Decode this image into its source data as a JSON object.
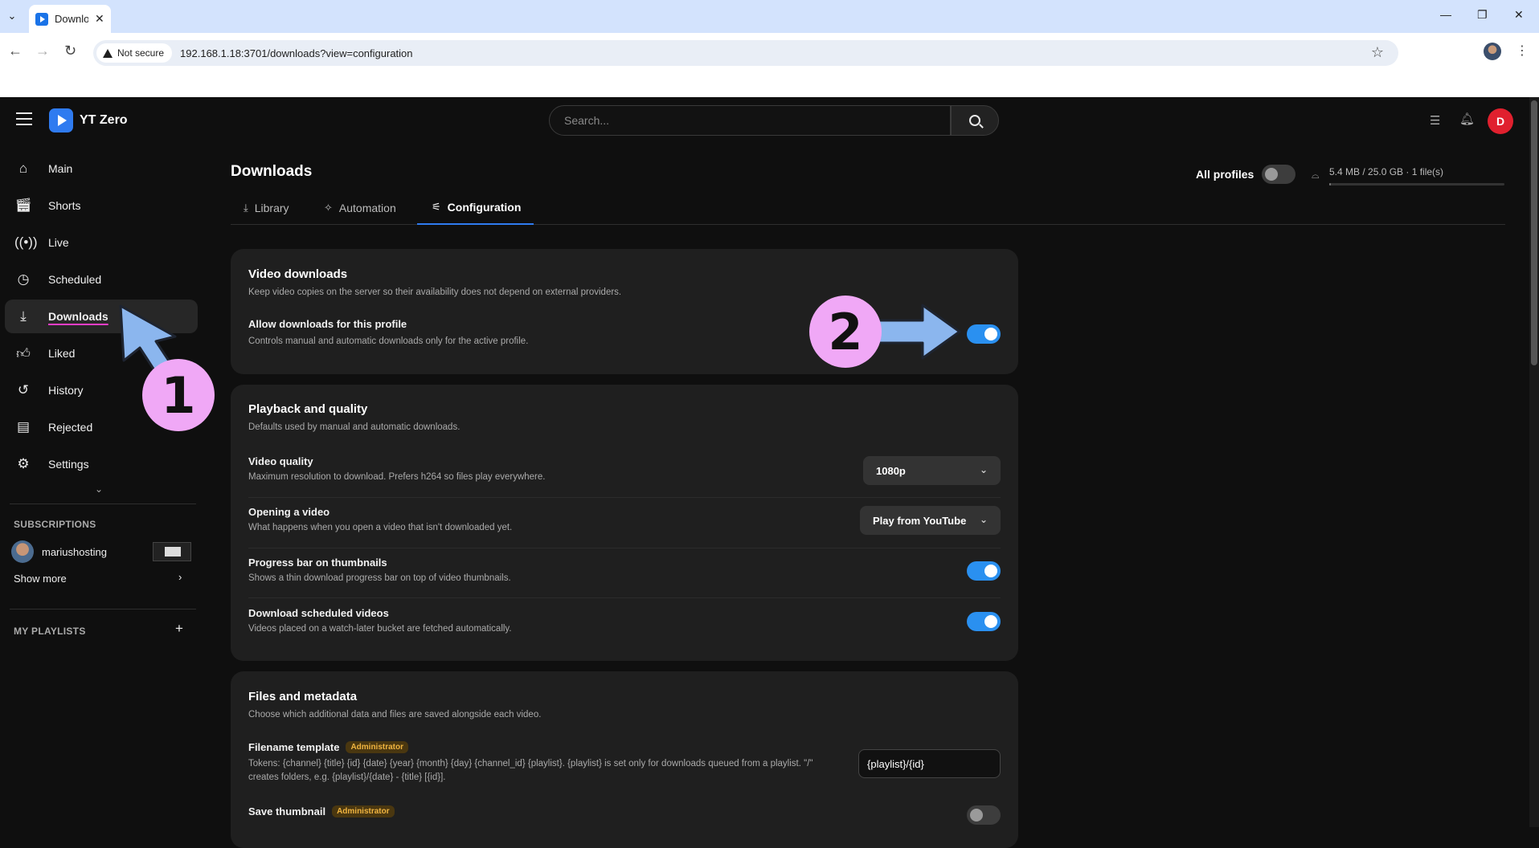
{
  "browser": {
    "tab_title": "Downlo",
    "security_label": "Not secure",
    "url": "192.168.1.18:3701/downloads?view=configuration"
  },
  "header": {
    "app_name": "YT Zero",
    "search_placeholder": "Search...",
    "avatar_letter": "D"
  },
  "sidebar": {
    "items": [
      {
        "label": "Main",
        "icon": "home-icon"
      },
      {
        "label": "Shorts",
        "icon": "clapper-icon"
      },
      {
        "label": "Live",
        "icon": "broadcast-icon"
      },
      {
        "label": "Scheduled",
        "icon": "clock-icon"
      },
      {
        "label": "Downloads",
        "icon": "download-icon",
        "active": true
      },
      {
        "label": "Liked",
        "icon": "thumbs-up-icon"
      },
      {
        "label": "History",
        "icon": "history-icon"
      },
      {
        "label": "Rejected",
        "icon": "archive-icon"
      },
      {
        "label": "Settings",
        "icon": "gear-icon"
      }
    ],
    "subscriptions_heading": "SUBSCRIPTIONS",
    "subscription_name": "mariushosting",
    "show_more": "Show more",
    "playlists_heading": "MY PLAYLISTS"
  },
  "page": {
    "title": "Downloads",
    "all_profiles_label": "All profiles",
    "all_profiles_on": false,
    "storage_text": "5.4 MB / 25.0 GB · 1 file(s)",
    "storage_fraction": 0.0002,
    "tabs": [
      {
        "label": "Library",
        "icon": "download-icon"
      },
      {
        "label": "Automation",
        "icon": "sparkle-icon"
      },
      {
        "label": "Configuration",
        "icon": "sliders-icon",
        "active": true
      }
    ]
  },
  "video_downloads": {
    "title": "Video downloads",
    "description": "Keep video copies on the server so their availability does not depend on external providers.",
    "allow_title": "Allow downloads for this profile",
    "allow_desc": "Controls manual and automatic downloads only for the active profile.",
    "allow_on": true
  },
  "playback": {
    "title": "Playback and quality",
    "description": "Defaults used by manual and automatic downloads.",
    "quality_title": "Video quality",
    "quality_desc": "Maximum resolution to download. Prefers h264 so files play everywhere.",
    "quality_value": "1080p",
    "opening_title": "Opening a video",
    "opening_desc": "What happens when you open a video that isn't downloaded yet.",
    "opening_value": "Play from YouTube",
    "progress_title": "Progress bar on thumbnails",
    "progress_desc": "Shows a thin download progress bar on top of video thumbnails.",
    "progress_on": true,
    "scheduled_title": "Download scheduled videos",
    "scheduled_desc": "Videos placed on a watch-later bucket are fetched automatically.",
    "scheduled_on": true
  },
  "files": {
    "title": "Files and metadata",
    "description": "Choose which additional data and files are saved alongside each video.",
    "filename_title": "Filename template",
    "admin_badge": "Administrator",
    "filename_desc": "Tokens: {channel} {title} {id} {date} {year} {month} {day} {channel_id} {playlist}. {playlist} is set only for downloads queued from a playlist. \"/\" creates folders, e.g. {playlist}/{date} - {title} [{id}].",
    "filename_value": "{playlist}/{id}",
    "thumb_title": "Save thumbnail",
    "thumb_on": false
  },
  "annotations": {
    "step1": "1",
    "step2": "2",
    "arrow_color": "#8bb6ee",
    "circle_color": "#f0a8f6"
  }
}
